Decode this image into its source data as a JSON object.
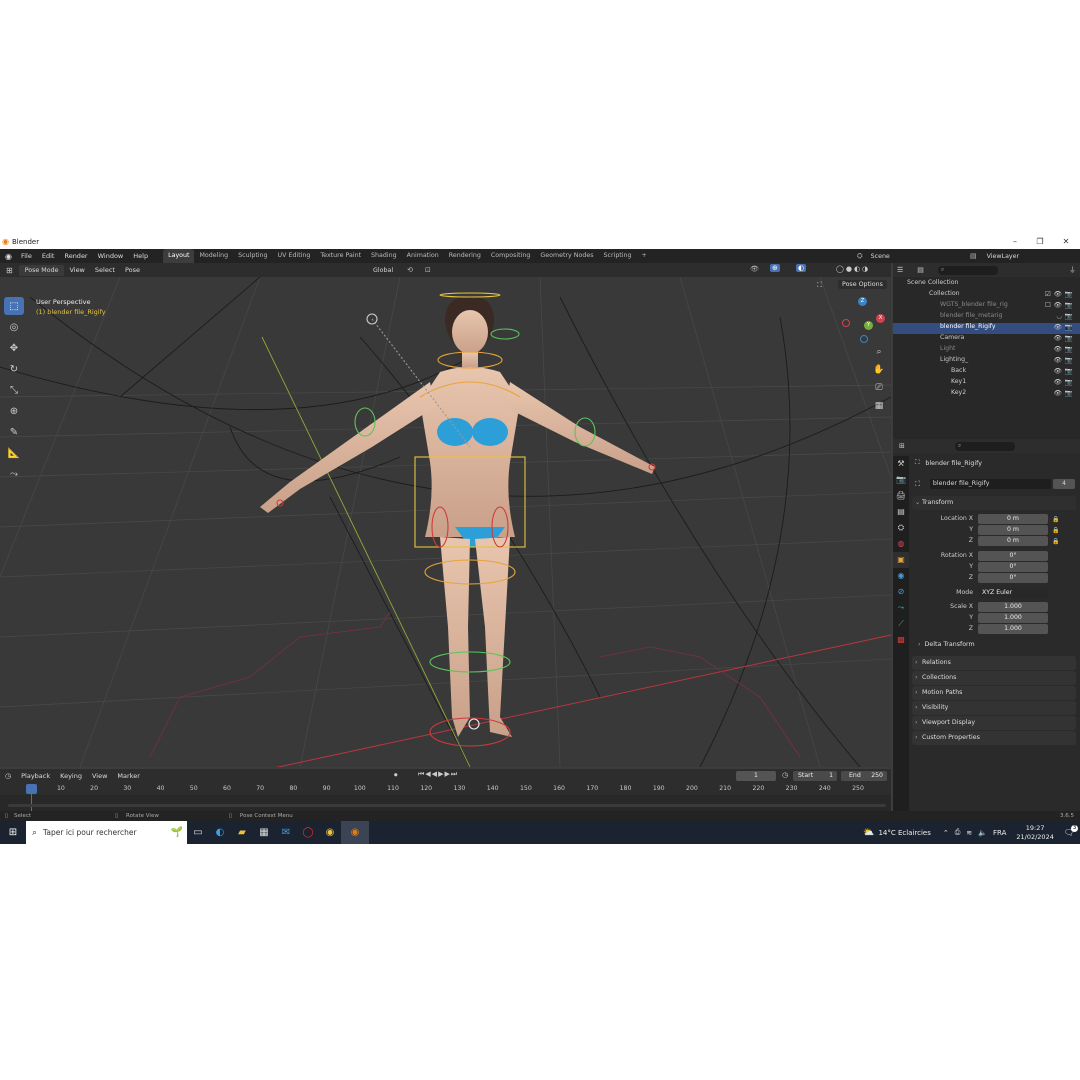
{
  "window": {
    "title": "Blender",
    "min": "–",
    "max": "❐",
    "close": "✕"
  },
  "menubar": {
    "menus": [
      "File",
      "Edit",
      "Render",
      "Window",
      "Help"
    ],
    "workspaces": [
      "Layout",
      "Modeling",
      "Sculpting",
      "UV Editing",
      "Texture Paint",
      "Shading",
      "Animation",
      "Rendering",
      "Compositing",
      "Geometry Nodes",
      "Scripting"
    ],
    "add_tab": "+",
    "scene": "Scene",
    "view_layer": "ViewLayer"
  },
  "viewport_header": {
    "mode": "Pose Mode",
    "menus": [
      "View",
      "Select",
      "Pose"
    ],
    "orientation": "Global"
  },
  "viewport": {
    "perspective": "User Perspective",
    "object": "(1) blender file_Rigify",
    "pose_options": "Pose Options",
    "gizmo": {
      "x": "X",
      "y": "Y",
      "z": "Z"
    }
  },
  "outliner": {
    "root": "Scene Collection",
    "items": [
      {
        "label": "Collection",
        "indent": 1,
        "type": "collection"
      },
      {
        "label": "WGTS_blender file_rig",
        "indent": 2,
        "type": "dim"
      },
      {
        "label": "blender file_metarig",
        "indent": 2,
        "type": "dim"
      },
      {
        "label": "blender file_Rigify",
        "indent": 2,
        "type": "selected"
      },
      {
        "label": "Camera",
        "indent": 2,
        "type": "normal"
      },
      {
        "label": "Light",
        "indent": 2,
        "type": "dim"
      },
      {
        "label": "Lighting_",
        "indent": 2,
        "type": "normal"
      },
      {
        "label": "Back",
        "indent": 3,
        "type": "normal"
      },
      {
        "label": "Key1",
        "indent": 3,
        "type": "normal"
      },
      {
        "label": "Key2",
        "indent": 3,
        "type": "normal"
      }
    ]
  },
  "properties": {
    "object_name": "blender file_Rigify",
    "data_name": "blender file_Rigify",
    "users": "4",
    "transform": "Transform",
    "location_label": "Location X",
    "rotation_label": "Rotation X",
    "scale_label": "Scale X",
    "y": "Y",
    "z": "Z",
    "mode_label": "Mode",
    "location": [
      "0 m",
      "0 m",
      "0 m"
    ],
    "rotation": [
      "0°",
      "0°",
      "0°"
    ],
    "mode": "XYZ Euler",
    "scale": [
      "1.000",
      "1.000",
      "1.000"
    ],
    "delta": "Delta Transform",
    "panels": [
      "Relations",
      "Collections",
      "Motion Paths",
      "Visibility",
      "Viewport Display",
      "Custom Properties"
    ]
  },
  "timeline": {
    "menus": [
      "Playback",
      "Keying",
      "View",
      "Marker"
    ],
    "current_frame": "1",
    "start_label": "Start",
    "start": "1",
    "end_label": "End",
    "end": "250",
    "ticks": [
      "1",
      "10",
      "20",
      "30",
      "40",
      "50",
      "60",
      "70",
      "80",
      "90",
      "100",
      "110",
      "120",
      "130",
      "140",
      "150",
      "160",
      "170",
      "180",
      "190",
      "200",
      "210",
      "220",
      "230",
      "240",
      "250"
    ]
  },
  "statusbar": {
    "select": "Select",
    "rotate": "Rotate View",
    "context": "Pose Context Menu",
    "version": "3.6.5"
  },
  "taskbar": {
    "search_placeholder": "Taper ici pour rechercher",
    "weather": "14°C  Eclaircies",
    "lang": "FRA",
    "time": "19:27",
    "date": "21/02/2024",
    "notif": "3"
  },
  "colors": {
    "accent": "#4772b3",
    "selected_row": "#334d80",
    "orange": "#e8a33a",
    "red": "#cf3b3b"
  }
}
